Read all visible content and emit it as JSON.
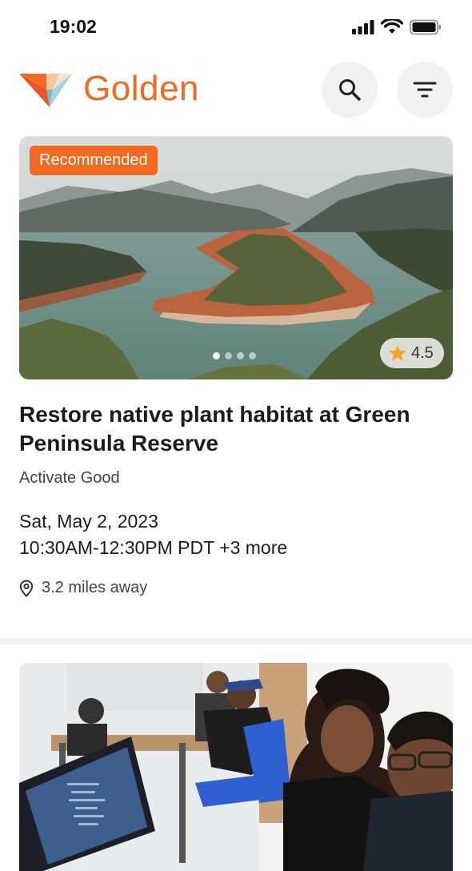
{
  "status_bar": {
    "time": "19:02"
  },
  "header": {
    "brand": "Golden"
  },
  "cards": [
    {
      "badge": "Recommended",
      "rating": "4.5",
      "title": "Restore native plant habitat at Green Peninsula Reserve",
      "organization": "Activate Good",
      "date": "Sat, May 2, 2023",
      "time_range": "10:30AM-12:30PM PDT +3 more",
      "distance": "3.2 miles away",
      "carousel": {
        "count": 4,
        "active": 1
      }
    }
  ],
  "colors": {
    "accent": "#f26a21"
  }
}
